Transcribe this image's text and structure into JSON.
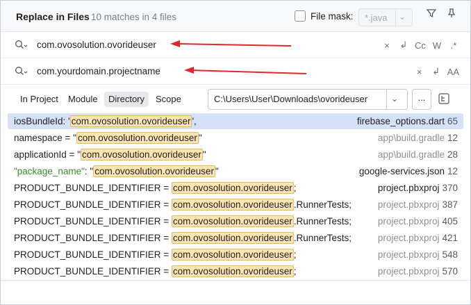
{
  "header": {
    "title": "Replace in Files",
    "subtitle": "10 matches in 4 files",
    "file_mask_label": "File mask:",
    "file_mask_value": "*.java",
    "icons": [
      "filter-icon",
      "pin-icon"
    ]
  },
  "search": {
    "value": "com.ovosolution.ovorideuser",
    "options": [
      "×",
      "↲",
      "Cc",
      "W",
      ".*"
    ]
  },
  "replace": {
    "value": "com.yourdomain.projectname",
    "options": [
      "×",
      "↲",
      "AA"
    ]
  },
  "scope": {
    "in_project": "In Project",
    "module": "Module",
    "directory": "Directory",
    "scope": "Scope",
    "directory_path": "C:\\Users\\User\\Downloads\\ovorideuser",
    "browse": "..."
  },
  "results": [
    {
      "pre": "iosBundleId: '",
      "match": "com.ovosolution.ovorideuser",
      "post": "',",
      "file": "firebase_options.dart",
      "line": "65"
    },
    {
      "pre": "namespace = \"",
      "match": "com.ovosolution.ovorideuser",
      "post": "\"",
      "file": "app\\build.gradle",
      "line": "12"
    },
    {
      "pre": "applicationId = \"",
      "match": "com.ovosolution.ovorideuser",
      "post": "\"",
      "file": "app\\build.gradle",
      "line": "28"
    },
    {
      "pre": "\"package_name\"",
      "pre2": ": \"",
      "match": "com.ovosolution.ovorideuser",
      "post": "\"",
      "file": "google-services.json",
      "line": "12"
    },
    {
      "pre": "PRODUCT_BUNDLE_IDENTIFIER = ",
      "match": "com.ovosolution.ovorideuser",
      "post": ";",
      "file": "project.pbxproj",
      "line": "370"
    },
    {
      "pre": "PRODUCT_BUNDLE_IDENTIFIER = ",
      "match": "com.ovosolution.ovorideuser",
      "post": ".RunnerTests;",
      "file": "project.pbxproj",
      "line": "387"
    },
    {
      "pre": "PRODUCT_BUNDLE_IDENTIFIER = ",
      "match": "com.ovosolution.ovorideuser",
      "post": ".RunnerTests;",
      "file": "project.pbxproj",
      "line": "405"
    },
    {
      "pre": "PRODUCT_BUNDLE_IDENTIFIER = ",
      "match": "com.ovosolution.ovorideuser",
      "post": ".RunnerTests;",
      "file": "project.pbxproj",
      "line": "421"
    },
    {
      "pre": "PRODUCT_BUNDLE_IDENTIFIER = ",
      "match": "com.ovosolution.ovorideuser",
      "post": ";",
      "file": "project.pbxproj",
      "line": "548"
    },
    {
      "pre": "PRODUCT_BUNDLE_IDENTIFIER = ",
      "match": "com.ovosolution.ovorideuser",
      "post": ";",
      "file": "project.pbxproj",
      "line": "570"
    }
  ],
  "colors": {
    "highlight": "#fde5b3",
    "selection": "#d5e1f7",
    "annotation_arrow": "#e3262b",
    "string_key_green": "#3a8a2a"
  }
}
